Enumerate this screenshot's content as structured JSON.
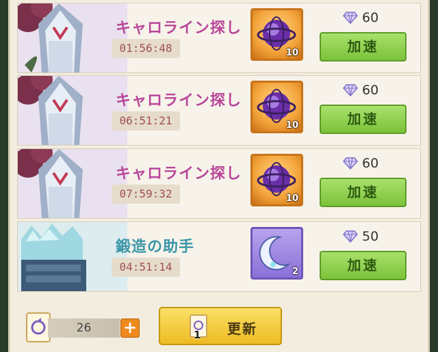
{
  "rows": [
    {
      "title": "キャロライン探し",
      "timer": "01:56:48",
      "reward_icon": "purple-orb-icon",
      "reward_count": "10",
      "gem_cost": "60",
      "speed_label": "加速"
    },
    {
      "title": "キャロライン探し",
      "timer": "06:51:21",
      "reward_icon": "purple-orb-icon",
      "reward_count": "10",
      "gem_cost": "60",
      "speed_label": "加速"
    },
    {
      "title": "キャロライン探し",
      "timer": "07:59:32",
      "reward_icon": "purple-orb-icon",
      "reward_count": "10",
      "gem_cost": "60",
      "speed_label": "加速"
    },
    {
      "title": "鍛造の助手",
      "timer": "04:51:14",
      "reward_icon": "crescent-moon-icon",
      "reward_count": "2",
      "gem_cost": "50",
      "speed_label": "加速"
    }
  ],
  "footer": {
    "ticket_count": "26",
    "refresh_label": "更新",
    "refresh_cost": "1"
  },
  "colors": {
    "title_pink": "#b9479a",
    "title_teal": "#3a96a8",
    "speed_green": "#7cc23b",
    "refresh_yellow": "#edbb22"
  }
}
